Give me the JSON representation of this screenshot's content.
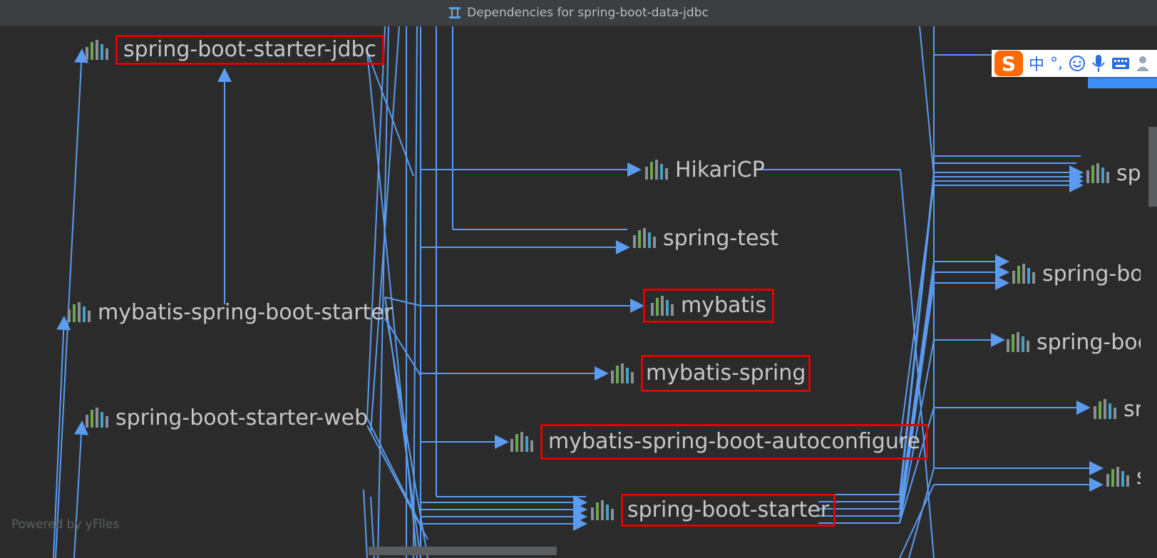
{
  "window": {
    "title": "Dependencies for spring-boot-data-jdbc"
  },
  "nodes": {
    "spring_boot_starter_jdbc": "spring-boot-starter-jdbc",
    "mybatis_spring_boot_starter": "mybatis-spring-boot-starter",
    "spring_boot_starter_web": "spring-boot-starter-web",
    "hikaricp": "HikariCP",
    "spring_test": "spring-test",
    "mybatis": "mybatis",
    "mybatis_spring": "mybatis-spring",
    "mybatis_spring_boot_autoconfigure": "mybatis-spring-boot-autoconfigure",
    "spring_boot_starter": "spring-boot-starter",
    "right_1": "sp",
    "right_2": "spring-boo",
    "right_3": "spring-boo",
    "right_4": "sr",
    "right_5": "s"
  },
  "footer": {
    "powered_by": "Powered by yFiles"
  },
  "ime": {
    "lang": "中",
    "punct": "°,",
    "logo": "S"
  },
  "colors": {
    "edge": "#5b9bf0",
    "highlight": "#e00000",
    "background": "#2b2b2b"
  },
  "icons": [
    "maven-module-icon",
    "dependencies-diagram-icon"
  ]
}
